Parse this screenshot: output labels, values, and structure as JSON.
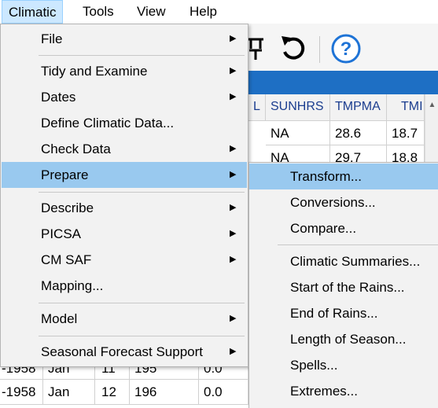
{
  "menubar": {
    "items": [
      "Climatic",
      "Tools",
      "View",
      "Help"
    ]
  },
  "toolbar": {
    "icons": [
      "pin-icon",
      "undo-icon",
      "help-icon"
    ],
    "help_glyph": "?"
  },
  "grid": {
    "headers": [
      "L",
      "SUNHRS",
      "TMPMA",
      "TMI"
    ],
    "top_rows": [
      [
        "NA",
        "28.6",
        "18.7"
      ],
      [
        "NA",
        "29.7",
        "18.8"
      ]
    ],
    "bottom_rows": [
      [
        "-1958",
        "Jan",
        "11",
        "195",
        "0.0"
      ],
      [
        "-1958",
        "Jan",
        "12",
        "196",
        "0.0"
      ]
    ]
  },
  "menu": {
    "items": [
      {
        "label": "File",
        "arrow": "▶"
      },
      {
        "label": "Tidy and Examine",
        "arrow": "▶"
      },
      {
        "label": "Dates",
        "arrow": "▶"
      },
      {
        "label": "Define Climatic Data...",
        "arrow": ""
      },
      {
        "label": "Check Data",
        "arrow": "▶"
      },
      {
        "label": "Prepare",
        "arrow": "▶"
      },
      {
        "label": "Describe",
        "arrow": "▶"
      },
      {
        "label": "PICSA",
        "arrow": "▶"
      },
      {
        "label": "CM SAF",
        "arrow": "▶"
      },
      {
        "label": "Mapping...",
        "arrow": ""
      },
      {
        "label": "Model",
        "arrow": "▶"
      },
      {
        "label": "Seasonal Forecast Support",
        "arrow": "▶"
      }
    ]
  },
  "submenu": {
    "items": [
      "Transform...",
      "Conversions...",
      "Compare...",
      "Climatic Summaries...",
      "Start of the Rains...",
      "End of Rains...",
      "Length of Season...",
      "Spells...",
      "Extremes..."
    ]
  },
  "colors": {
    "highlight": "#99c9ef",
    "menubar_active": "#cce8ff",
    "header_band": "#1e6fc4",
    "help_blue": "#1e73d6"
  }
}
